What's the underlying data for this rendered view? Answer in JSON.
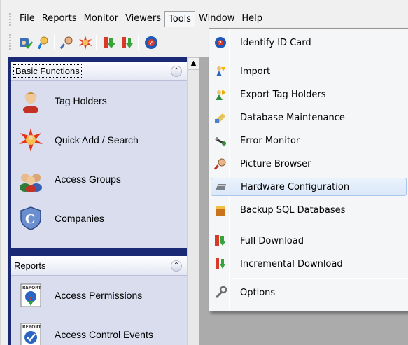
{
  "menubar": {
    "items": [
      "File",
      "Reports",
      "Monitor",
      "Viewers",
      "Tools",
      "Window",
      "Help"
    ],
    "open_menu": "Tools"
  },
  "tools_menu": {
    "items": [
      {
        "label": "Identify ID Card",
        "icon": "id-card-icon"
      },
      {
        "label": "Import",
        "icon": "import-icon"
      },
      {
        "label": "Export Tag Holders",
        "icon": "export-icon"
      },
      {
        "label": "Database Maintenance",
        "icon": "database-icon"
      },
      {
        "label": "Error Monitor",
        "icon": "error-monitor-icon"
      },
      {
        "label": "Picture Browser",
        "icon": "picture-browser-icon"
      },
      {
        "label": "Hardware Configuration",
        "icon": "hardware-icon"
      },
      {
        "label": "Backup SQL Databases",
        "icon": "backup-icon"
      },
      {
        "label": "Full Download",
        "icon": "full-download-icon"
      },
      {
        "label": "Incremental Download",
        "icon": "incremental-download-icon"
      },
      {
        "label": "Options",
        "icon": "wrench-icon"
      }
    ],
    "highlighted": "Hardware Configuration"
  },
  "nav": {
    "basic": {
      "title": "Basic Functions",
      "items": [
        {
          "label": "Tag Holders",
          "icon": "person-icon"
        },
        {
          "label": "Quick Add / Search",
          "icon": "starburst-icon"
        },
        {
          "label": "Access Groups",
          "icon": "group-icon"
        },
        {
          "label": "Companies",
          "icon": "company-icon"
        }
      ]
    },
    "reports": {
      "title": "Reports",
      "items": [
        {
          "label": "Access Permissions",
          "icon": "report-icon"
        },
        {
          "label": "Access Control Events",
          "icon": "report-icon"
        }
      ]
    }
  },
  "colors": {
    "nav_background": "#1a2a74",
    "section_background": "#d9ddee",
    "highlight": "#dbe8f9",
    "workarea": "#ababab"
  }
}
